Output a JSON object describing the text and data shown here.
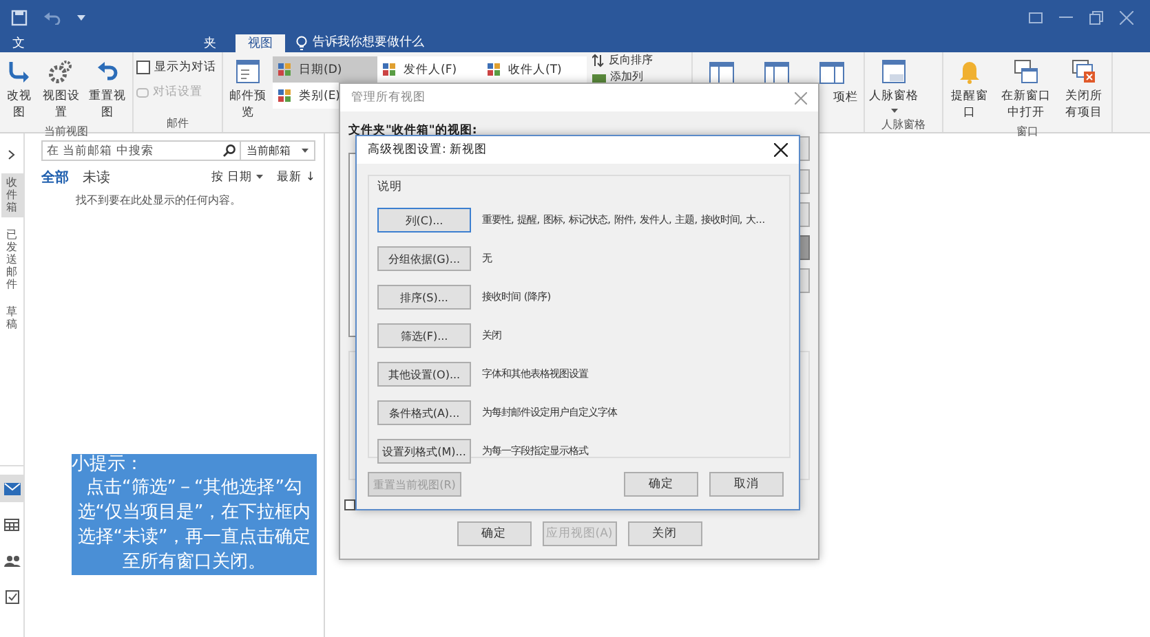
{
  "tabs": [
    {
      "label": "文",
      "selected": false
    },
    {
      "label": "夹",
      "selected": false
    },
    {
      "label": "视图",
      "selected": true
    }
  ],
  "tell_me": "告诉我你想要做什么",
  "ribbon": {
    "current_view": {
      "label": "当前视图",
      "buttons": [
        "改视图",
        "视图设置",
        "重置视图"
      ]
    },
    "mail": {
      "label": "邮件",
      "show_as_conversation": {
        "label": "显示为对话",
        "checked": false
      },
      "conversation_settings": {
        "label": "对话设置",
        "disabled": true
      }
    },
    "message_preview": "邮件预览",
    "arrangement": [
      {
        "label": "日期(D)",
        "selected": true
      },
      {
        "label": "发件人(F)",
        "selected": false
      },
      {
        "label": "收件人(T)",
        "selected": false
      },
      {
        "label": "类别(E)",
        "selected": false
      }
    ],
    "reverse_sort": "反向排序",
    "add_columns": "添加列",
    "layout_partial_label": "项栏",
    "people_pane": {
      "label": "人脉窗格",
      "button": "人脉窗格"
    },
    "window_group": {
      "label": "窗口",
      "buttons": [
        "提醒窗口",
        "在新窗口中打开",
        "关闭所有项目"
      ]
    }
  },
  "nav": {
    "folders": [
      {
        "label": "收件箱",
        "selected": true
      },
      {
        "label": "已发送邮件",
        "selected": false
      },
      {
        "label": "草稿",
        "selected": false
      }
    ],
    "modules": [
      {
        "selected": true
      },
      {
        "selected": false
      },
      {
        "selected": false
      },
      {
        "selected": false
      }
    ]
  },
  "mail_list": {
    "search_placeholder": "在 当前邮箱 中搜索",
    "scope": "当前邮箱",
    "filters": [
      {
        "label": "全部",
        "selected": true
      },
      {
        "label": "未读",
        "selected": false
      }
    ],
    "sort": "按 日期",
    "order": "最新",
    "order_arrow": "↓",
    "empty_message": "找不到要在此处显示的任何内容。"
  },
  "tip": {
    "title": "小提示：",
    "body": "点击“筛选”－“其他选择”勾选“仅当项目是”，在下拉框内选择“未读”，再一直点击确定至所有窗口关闭。"
  },
  "manage_views": {
    "title": "管理所有视图",
    "list_label": "文件夹\"收件箱\"的视图:",
    "side_buttons": [
      {
        "disabled": false
      },
      {
        "disabled": false
      },
      {
        "disabled": false
      },
      {
        "disabled": true
      },
      {
        "disabled": false
      }
    ],
    "checkbox": {
      "checked": false
    },
    "buttons": [
      {
        "label": "确定",
        "disabled": false
      },
      {
        "label": "应用视图(A)",
        "disabled": true
      },
      {
        "label": "关闭",
        "disabled": false
      }
    ]
  },
  "advanced_view": {
    "title": "高级视图设置: 新视图",
    "group_label": "说明",
    "rows": [
      {
        "button": "列(C)...",
        "description": "重要性, 提醒, 图标, 标记状态, 附件, 发件人, 主题, 接收时间, 大...",
        "focused": true
      },
      {
        "button": "分组依据(G)...",
        "description": "无",
        "focused": false
      },
      {
        "button": "排序(S)...",
        "description": "接收时间 (降序)",
        "focused": false
      },
      {
        "button": "筛选(F)...",
        "description": "关闭",
        "focused": false
      },
      {
        "button": "其他设置(O)...",
        "description": "字体和其他表格视图设置",
        "focused": false
      },
      {
        "button": "条件格式(A)...",
        "description": "为每封邮件设定用户自定义字体",
        "focused": false
      },
      {
        "button": "设置列格式(M)...",
        "description": "为每一字段指定显示格式",
        "focused": false
      }
    ],
    "reset": {
      "label": "重置当前视图(R)",
      "disabled": true
    },
    "ok": "确定",
    "cancel": "取消"
  }
}
